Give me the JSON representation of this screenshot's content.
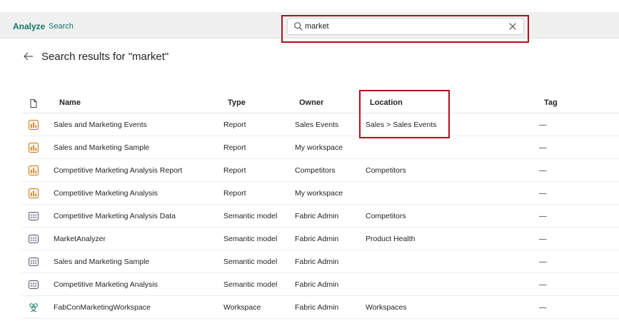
{
  "header": {
    "brand": "Analyze",
    "breadcrumb": "Search"
  },
  "search": {
    "value": "market",
    "placeholder": ""
  },
  "page": {
    "title": "Search results for \"market\""
  },
  "table": {
    "columns": {
      "name": "Name",
      "type": "Type",
      "owner": "Owner",
      "location": "Location",
      "tag": "Tag"
    },
    "rows": [
      {
        "icon": "report-icon",
        "name": "Sales and Marketing Events",
        "type": "Report",
        "owner": "Sales Events",
        "location": "Sales > Sales Events",
        "tag": "—"
      },
      {
        "icon": "report-icon",
        "name": "Sales and Marketing Sample",
        "type": "Report",
        "owner": "My workspace",
        "location": "",
        "tag": "—"
      },
      {
        "icon": "report-icon",
        "name": "Competitive Marketing Analysis Report",
        "type": "Report",
        "owner": "Competitors",
        "location": "Competitors",
        "tag": "—"
      },
      {
        "icon": "report-icon",
        "name": "Competitive Marketing Analysis",
        "type": "Report",
        "owner": "My workspace",
        "location": "",
        "tag": "—"
      },
      {
        "icon": "semantic-model-icon",
        "name": "Competitive Marketing Analysis Data",
        "type": "Semantic model",
        "owner": "Fabric Admin",
        "location": "Competitors",
        "tag": "—"
      },
      {
        "icon": "semantic-model-icon",
        "name": "MarketAnalyzer",
        "type": "Semantic model",
        "owner": "Fabric Admin",
        "location": "Product Health",
        "tag": "—"
      },
      {
        "icon": "semantic-model-icon",
        "name": "Sales and Marketing Sample",
        "type": "Semantic model",
        "owner": "Fabric Admin",
        "location": "",
        "tag": "—"
      },
      {
        "icon": "semantic-model-icon",
        "name": "Competitive Marketing Analysis",
        "type": "Semantic model",
        "owner": "Fabric Admin",
        "location": "",
        "tag": "—"
      },
      {
        "icon": "workspace-icon",
        "name": "FabConMarketingWorkspace",
        "type": "Workspace",
        "owner": "Fabric Admin",
        "location": "Workspaces",
        "tag": "—"
      }
    ]
  },
  "colors": {
    "brand": "#117865",
    "highlight": "#b0101e",
    "report_icon": "#c67a1a",
    "model_icon": "#5a5a6e",
    "workspace_icon": "#117865"
  }
}
